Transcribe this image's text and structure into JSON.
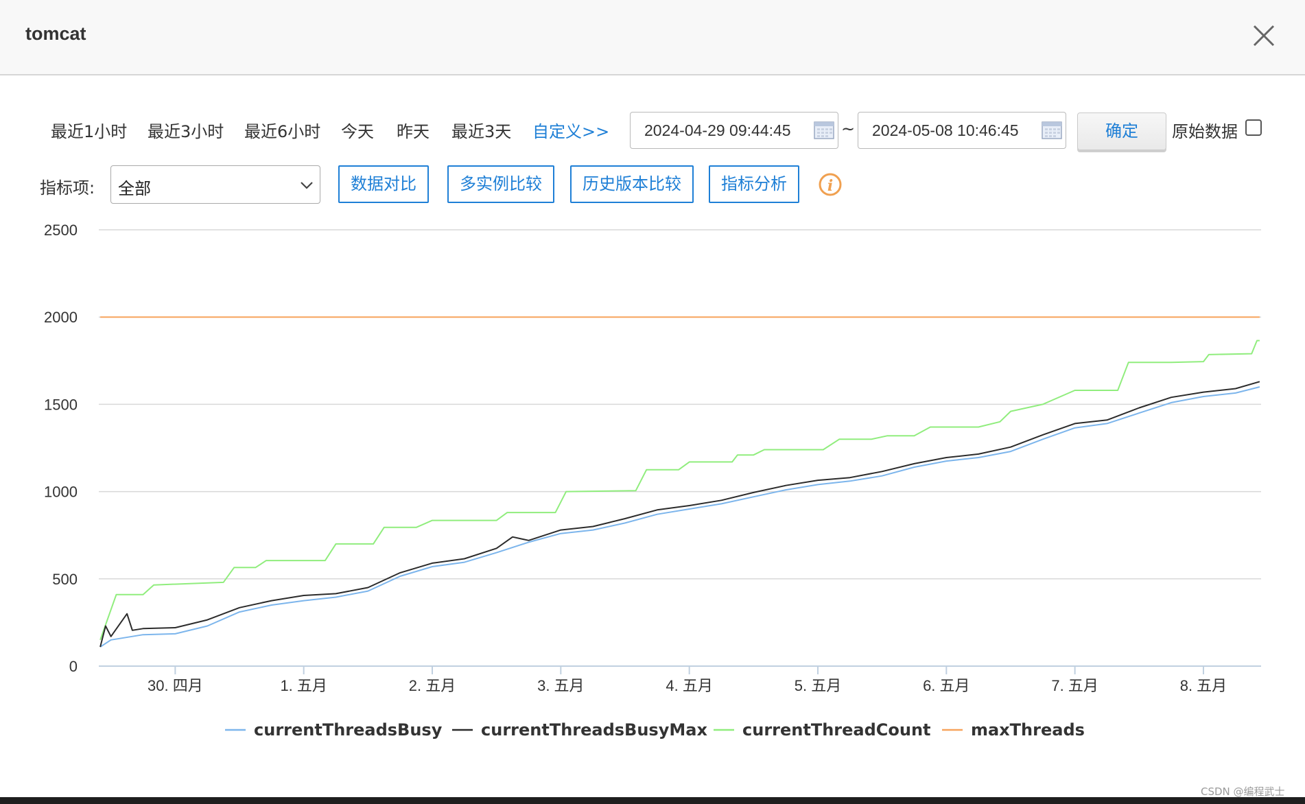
{
  "window": {
    "title": "tomcat"
  },
  "toolbar": {
    "ranges": [
      "最近1小时",
      "最近3小时",
      "最近6小时",
      "今天",
      "昨天",
      "最近3天"
    ],
    "custom": "自定义>>",
    "start": "2024-04-29 09:44:45",
    "separator": "~",
    "end": "2024-05-08 10:46:45",
    "confirm": "确定",
    "raw_label": "原始数据"
  },
  "metric": {
    "label": "指标项:",
    "selected": "全部",
    "buttons": [
      "数据对比",
      "多实例比较",
      "历史版本比较",
      "指标分析"
    ]
  },
  "colors": {
    "accent": "#1e7fd6",
    "currentThreadsBusy": "#7cb5ec",
    "currentThreadsBusyMax": "#2b2b2b",
    "currentThreadCount": "#90ed7d",
    "maxThreads": "#f7a35c",
    "info": "#f0a050"
  },
  "icons": {
    "close": "close-icon",
    "calendar": "calendar-icon",
    "chevron": "chevron-down-icon",
    "info": "info-icon"
  },
  "chart_data": {
    "type": "line",
    "y_ticks": [
      0,
      500,
      1000,
      1500,
      2000,
      2500
    ],
    "ylim": [
      0,
      2500
    ],
    "x_ticks": [
      "30. 四月",
      "1. 五月",
      "2. 五月",
      "3. 五月",
      "4. 五月",
      "5. 五月",
      "6. 五月",
      "7. 五月",
      "8. 五月"
    ],
    "xlim": [
      "2024-04-29 09:44",
      "2024-05-08 10:46"
    ],
    "grid": true,
    "legend_position": "bottom-center",
    "series": [
      {
        "name": "currentThreadsBusy",
        "color": "#7cb5ec",
        "points": [
          [
            "2024-04-29 10:00",
            110
          ],
          [
            "2024-04-29 12:00",
            150
          ],
          [
            "2024-04-29 18:00",
            180
          ],
          [
            "2024-04-30 00:00",
            185
          ],
          [
            "2024-04-30 06:00",
            230
          ],
          [
            "2024-04-30 12:00",
            310
          ],
          [
            "2024-04-30 18:00",
            350
          ],
          [
            "2024-05-01 00:00",
            375
          ],
          [
            "2024-05-01 06:00",
            395
          ],
          [
            "2024-05-01 12:00",
            430
          ],
          [
            "2024-05-01 18:00",
            515
          ],
          [
            "2024-05-02 00:00",
            570
          ],
          [
            "2024-05-02 06:00",
            595
          ],
          [
            "2024-05-02 12:00",
            650
          ],
          [
            "2024-05-02 18:00",
            710
          ],
          [
            "2024-05-03 00:00",
            760
          ],
          [
            "2024-05-03 06:00",
            780
          ],
          [
            "2024-05-03 12:00",
            820
          ],
          [
            "2024-05-03 18:00",
            870
          ],
          [
            "2024-05-04 00:00",
            900
          ],
          [
            "2024-05-04 06:00",
            930
          ],
          [
            "2024-05-04 12:00",
            970
          ],
          [
            "2024-05-04 18:00",
            1010
          ],
          [
            "2024-05-05 00:00",
            1040
          ],
          [
            "2024-05-05 06:00",
            1060
          ],
          [
            "2024-05-05 12:00",
            1090
          ],
          [
            "2024-05-05 18:00",
            1140
          ],
          [
            "2024-05-06 00:00",
            1175
          ],
          [
            "2024-05-06 06:00",
            1195
          ],
          [
            "2024-05-06 12:00",
            1230
          ],
          [
            "2024-05-06 18:00",
            1300
          ],
          [
            "2024-05-07 00:00",
            1365
          ],
          [
            "2024-05-07 06:00",
            1390
          ],
          [
            "2024-05-07 12:00",
            1450
          ],
          [
            "2024-05-07 18:00",
            1510
          ],
          [
            "2024-05-08 00:00",
            1545
          ],
          [
            "2024-05-08 06:00",
            1565
          ],
          [
            "2024-05-08 10:30",
            1600
          ]
        ]
      },
      {
        "name": "currentThreadsBusyMax",
        "color": "#2b2b2b",
        "points": [
          [
            "2024-04-29 10:00",
            110
          ],
          [
            "2024-04-29 11:00",
            230
          ],
          [
            "2024-04-29 12:00",
            170
          ],
          [
            "2024-04-29 15:00",
            300
          ],
          [
            "2024-04-29 16:00",
            205
          ],
          [
            "2024-04-29 18:00",
            215
          ],
          [
            "2024-04-30 00:00",
            220
          ],
          [
            "2024-04-30 06:00",
            265
          ],
          [
            "2024-04-30 12:00",
            335
          ],
          [
            "2024-04-30 18:00",
            375
          ],
          [
            "2024-05-01 00:00",
            405
          ],
          [
            "2024-05-01 06:00",
            415
          ],
          [
            "2024-05-01 12:00",
            450
          ],
          [
            "2024-05-01 18:00",
            535
          ],
          [
            "2024-05-02 00:00",
            590
          ],
          [
            "2024-05-02 06:00",
            615
          ],
          [
            "2024-05-02 12:00",
            675
          ],
          [
            "2024-05-02 15:00",
            740
          ],
          [
            "2024-05-02 18:00",
            720
          ],
          [
            "2024-05-03 00:00",
            780
          ],
          [
            "2024-05-03 06:00",
            800
          ],
          [
            "2024-05-03 12:00",
            845
          ],
          [
            "2024-05-03 18:00",
            895
          ],
          [
            "2024-05-04 00:00",
            920
          ],
          [
            "2024-05-04 06:00",
            950
          ],
          [
            "2024-05-04 12:00",
            995
          ],
          [
            "2024-05-04 18:00",
            1035
          ],
          [
            "2024-05-05 00:00",
            1065
          ],
          [
            "2024-05-05 06:00",
            1080
          ],
          [
            "2024-05-05 12:00",
            1115
          ],
          [
            "2024-05-05 18:00",
            1160
          ],
          [
            "2024-05-06 00:00",
            1195
          ],
          [
            "2024-05-06 06:00",
            1215
          ],
          [
            "2024-05-06 12:00",
            1255
          ],
          [
            "2024-05-06 18:00",
            1325
          ],
          [
            "2024-05-07 00:00",
            1390
          ],
          [
            "2024-05-07 06:00",
            1410
          ],
          [
            "2024-05-07 12:00",
            1480
          ],
          [
            "2024-05-07 18:00",
            1540
          ],
          [
            "2024-05-08 00:00",
            1570
          ],
          [
            "2024-05-08 06:00",
            1590
          ],
          [
            "2024-05-08 10:30",
            1630
          ]
        ]
      },
      {
        "name": "currentThreadCount",
        "color": "#90ed7d",
        "points": [
          [
            "2024-04-29 10:00",
            150
          ],
          [
            "2024-04-29 13:00",
            410
          ],
          [
            "2024-04-29 18:00",
            410
          ],
          [
            "2024-04-29 20:00",
            465
          ],
          [
            "2024-04-30 09:00",
            480
          ],
          [
            "2024-04-30 11:00",
            565
          ],
          [
            "2024-04-30 15:00",
            565
          ],
          [
            "2024-04-30 17:00",
            605
          ],
          [
            "2024-05-01 04:00",
            605
          ],
          [
            "2024-05-01 06:00",
            700
          ],
          [
            "2024-05-01 13:00",
            700
          ],
          [
            "2024-05-01 15:00",
            795
          ],
          [
            "2024-05-01 21:00",
            795
          ],
          [
            "2024-05-02 00:00",
            835
          ],
          [
            "2024-05-02 12:00",
            835
          ],
          [
            "2024-05-02 14:00",
            880
          ],
          [
            "2024-05-02 23:00",
            880
          ],
          [
            "2024-05-03 01:00",
            1000
          ],
          [
            "2024-05-03 14:00",
            1005
          ],
          [
            "2024-05-03 16:00",
            1125
          ],
          [
            "2024-05-03 22:00",
            1125
          ],
          [
            "2024-05-04 00:00",
            1170
          ],
          [
            "2024-05-04 08:00",
            1170
          ],
          [
            "2024-05-04 09:00",
            1210
          ],
          [
            "2024-05-04 12:00",
            1210
          ],
          [
            "2024-05-04 14:00",
            1240
          ],
          [
            "2024-05-05 01:00",
            1240
          ],
          [
            "2024-05-05 04:00",
            1300
          ],
          [
            "2024-05-05 10:00",
            1300
          ],
          [
            "2024-05-05 13:00",
            1320
          ],
          [
            "2024-05-05 18:00",
            1320
          ],
          [
            "2024-05-05 21:00",
            1370
          ],
          [
            "2024-05-06 06:00",
            1370
          ],
          [
            "2024-05-06 10:00",
            1400
          ],
          [
            "2024-05-06 12:00",
            1460
          ],
          [
            "2024-05-06 18:00",
            1500
          ],
          [
            "2024-05-07 00:00",
            1580
          ],
          [
            "2024-05-07 08:00",
            1580
          ],
          [
            "2024-05-07 10:00",
            1740
          ],
          [
            "2024-05-07 18:00",
            1740
          ],
          [
            "2024-05-08 00:00",
            1745
          ],
          [
            "2024-05-08 01:00",
            1785
          ],
          [
            "2024-05-08 09:00",
            1790
          ],
          [
            "2024-05-08 10:00",
            1865
          ],
          [
            "2024-05-08 10:30",
            1865
          ]
        ]
      },
      {
        "name": "maxThreads",
        "color": "#f7a35c",
        "points": [
          [
            "2024-04-29 10:00",
            2000
          ],
          [
            "2024-05-08 10:30",
            2000
          ]
        ]
      }
    ]
  },
  "watermark": "CSDN @编程武士"
}
